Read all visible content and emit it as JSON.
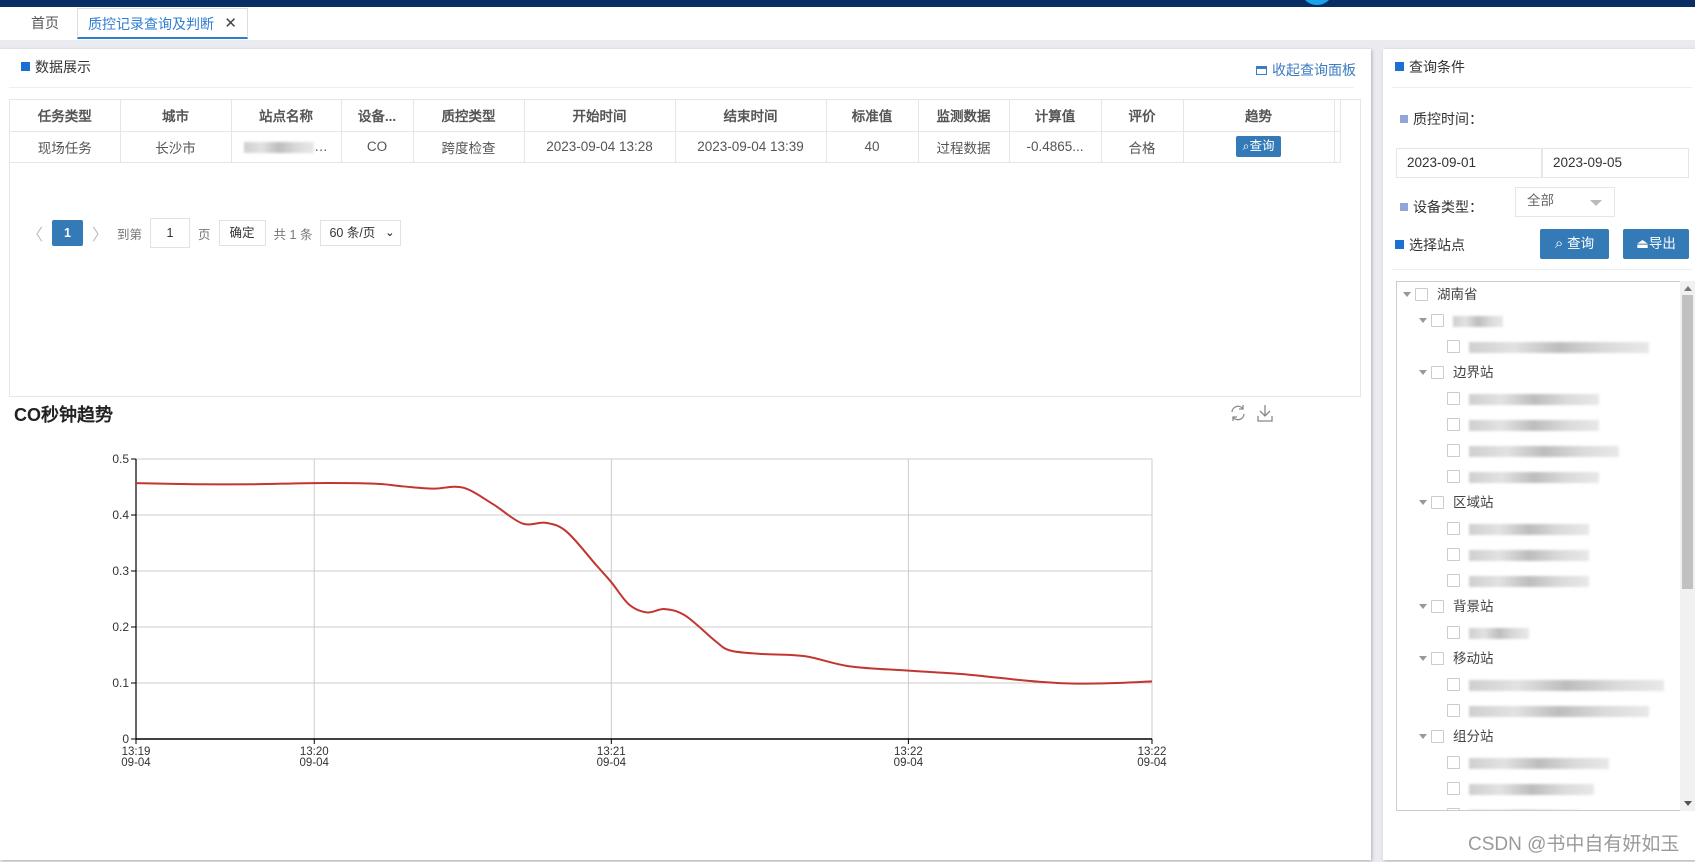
{
  "tabs": [
    {
      "label": "首页",
      "active": false
    },
    {
      "label": "质控记录查询及判断",
      "active": true,
      "close_glyph": "✕"
    }
  ],
  "data_panel": {
    "title": "数据展示",
    "collapse_label": "收起查询面板",
    "table": {
      "columns": [
        "任务类型",
        "城市",
        "站点名称",
        "设备...",
        "质控类型",
        "开始时间",
        "结束时间",
        "标准值",
        "监测数据",
        "计算值",
        "评价",
        "趋势"
      ],
      "rows": [
        {
          "task_type": "现场任务",
          "city": "长沙市",
          "station": "[redacted]...",
          "device": "CO",
          "qc_type": "跨度检查",
          "start": "2023-09-04 13:28",
          "end": "2023-09-04 13:39",
          "standard": "40",
          "monitor_data": "过程数据",
          "calc_value": "-0.4865...",
          "evaluation": "合格",
          "trend_button": "查询"
        }
      ]
    },
    "pager": {
      "prev": "〈",
      "current_page": "1",
      "next": "〉",
      "goto_label": "到第",
      "goto_value": "1",
      "page_unit": "页",
      "confirm": "确定",
      "total": "共 1 条",
      "page_size": "60 条/页"
    }
  },
  "chart_panel": {
    "title": "CO秒钟趋势",
    "tools": [
      "refresh-icon",
      "download-icon"
    ]
  },
  "chart_data": {
    "type": "line",
    "title": "CO秒钟趋势",
    "xlabel": "",
    "ylabel": "",
    "ylim": [
      0,
      0.5
    ],
    "yticks": [
      "0",
      "0.1",
      "0.2",
      "0.3",
      "0.4",
      "0.5"
    ],
    "xlim_minutes": [
      0,
      3.42
    ],
    "xticks": [
      {
        "at": 0,
        "line1": "13:19",
        "line2": "09-04"
      },
      {
        "at": 0.6,
        "line1": "13:20",
        "line2": "09-04"
      },
      {
        "at": 1.6,
        "line1": "13:21",
        "line2": "09-04"
      },
      {
        "at": 2.6,
        "line1": "13:22",
        "line2": "09-04"
      },
      {
        "at": 3.42,
        "line1": "13:22",
        "line2": "09-04"
      }
    ],
    "grid": true,
    "color": "#c23531",
    "series": [
      {
        "name": "CO",
        "x": [
          0,
          0.2,
          0.4,
          0.6,
          0.8,
          0.9,
          1.0,
          1.1,
          1.2,
          1.3,
          1.38,
          1.45,
          1.55,
          1.6,
          1.66,
          1.72,
          1.78,
          1.85,
          1.95,
          2.0,
          2.1,
          2.25,
          2.4,
          2.6,
          2.8,
          3.0,
          3.15,
          3.3,
          3.42
        ],
        "y": [
          0.457,
          0.455,
          0.455,
          0.457,
          0.456,
          0.451,
          0.447,
          0.449,
          0.42,
          0.385,
          0.386,
          0.37,
          0.31,
          0.28,
          0.24,
          0.226,
          0.232,
          0.22,
          0.175,
          0.158,
          0.152,
          0.148,
          0.13,
          0.122,
          0.115,
          0.104,
          0.099,
          0.1,
          0.103
        ]
      }
    ]
  },
  "query_panel": {
    "title": "查询条件",
    "qc_time_label": "质控时间：",
    "start_date": "2023-09-01",
    "end_date": "2023-09-05",
    "device_type_label": "设备类型：",
    "device_type_value": "全部",
    "select_station_label": "选择站点",
    "query_button": "查询",
    "export_button": "导出",
    "tree": [
      {
        "level": 0,
        "label": "湖南省",
        "expandable": true,
        "redacted": false
      },
      {
        "level": 1,
        "label": "超级站",
        "expandable": true,
        "redacted": true
      },
      {
        "level": 2,
        "label": "湖南省环境监测中心站",
        "expandable": false,
        "redacted": true
      },
      {
        "level": 1,
        "label": "边界站",
        "expandable": true,
        "redacted": false
      },
      {
        "level": 2,
        "label": "[redacted]",
        "expandable": false,
        "redacted": true
      },
      {
        "level": 2,
        "label": "岳阳市[redacted]",
        "expandable": false,
        "redacted": true
      },
      {
        "level": 2,
        "label": "[redacted]中学",
        "expandable": false,
        "redacted": true
      },
      {
        "level": 2,
        "label": "长沙市[redacted]站",
        "expandable": false,
        "redacted": true
      },
      {
        "level": 1,
        "label": "区域站",
        "expandable": true,
        "redacted": false
      },
      {
        "level": 2,
        "label": "株洲市[redacted]",
        "expandable": false,
        "redacted": true
      },
      {
        "level": 2,
        "label": "[redacted]",
        "expandable": false,
        "redacted": true
      },
      {
        "level": 2,
        "label": "[redacted]",
        "expandable": false,
        "redacted": true
      },
      {
        "level": 1,
        "label": "背景站",
        "expandable": true,
        "redacted": false
      },
      {
        "level": 2,
        "label": "[redacted]",
        "expandable": false,
        "redacted": true
      },
      {
        "level": 1,
        "label": "移动站",
        "expandable": true,
        "redacted": false
      },
      {
        "level": 2,
        "label": "湖南省[redacted]",
        "expandable": false,
        "redacted": true
      },
      {
        "level": 2,
        "label": "岳阳市大气移动VOCs监测车",
        "expandable": false,
        "redacted": true
      },
      {
        "level": 1,
        "label": "组分站",
        "expandable": true,
        "redacted": false
      },
      {
        "level": 2,
        "label": "长沙市高新环保局站",
        "expandable": false,
        "redacted": true
      },
      {
        "level": 2,
        "label": "长沙市环保学院站",
        "expandable": false,
        "redacted": true
      },
      {
        "level": 2,
        "label": "长沙市马坡岭站",
        "expandable": false,
        "redacted": true
      }
    ]
  },
  "watermark": "CSDN @书中自有妍如玉"
}
